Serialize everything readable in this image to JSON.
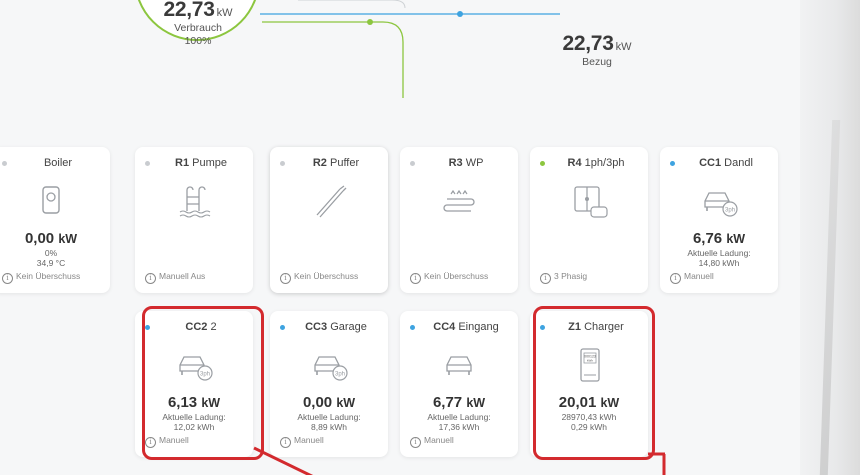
{
  "flow": {
    "consumption": {
      "value": "22,73",
      "unit": "kW",
      "label": "Verbrauch",
      "percent": "100%"
    },
    "grid": {
      "value": "22,73",
      "unit": "kW",
      "label": "Bezug"
    }
  },
  "colors": {
    "green": "#8cc63f",
    "blue": "#3ea3e0",
    "highlight": "#d32a2e"
  },
  "cards": [
    {
      "prefix": "",
      "name": "Boiler",
      "power": "0,00",
      "unit": "kW",
      "sub": [
        "0%",
        "34,9 °C"
      ],
      "footer": "Kein Überschuss",
      "icon": "boiler-icon",
      "status_color": "#c9ccd0"
    },
    {
      "prefix": "R1",
      "name": "Pumpe",
      "power": "",
      "unit": "",
      "sub": [],
      "footer": "Manuell Aus",
      "icon": "pool-ladder-icon",
      "status_color": "#c9ccd0"
    },
    {
      "prefix": "R2",
      "name": "Puffer",
      "power": "",
      "unit": "",
      "sub": [],
      "footer": "Kein Überschuss",
      "icon": "heating-rod-icon",
      "status_color": "#c9ccd0"
    },
    {
      "prefix": "R3",
      "name": "WP",
      "power": "",
      "unit": "",
      "sub": [],
      "footer": "Kein Überschuss",
      "icon": "heat-pump-icon",
      "status_color": "#c9ccd0"
    },
    {
      "prefix": "R4",
      "name": "1ph/3ph",
      "power": "",
      "unit": "",
      "sub": [],
      "footer": "3 Phasig",
      "icon": "phase-switch-icon",
      "status_color": "#8cc63f"
    },
    {
      "prefix": "CC1",
      "name": "Dandl",
      "power": "6,76",
      "unit": "kW",
      "sub": [
        "Aktuelle Ladung:",
        "14,80 kWh"
      ],
      "footer": "Manuell",
      "icon": "car-3ph-icon",
      "status_color": "#3ea3e0"
    },
    {
      "prefix": "CC2",
      "name": "2",
      "power": "6,13",
      "unit": "kW",
      "sub": [
        "Aktuelle Ladung:",
        "12,02 kWh"
      ],
      "footer": "Manuell",
      "icon": "car-3ph-icon",
      "status_color": "#3ea3e0"
    },
    {
      "prefix": "CC3",
      "name": "Garage",
      "power": "0,00",
      "unit": "kW",
      "sub": [
        "Aktuelle Ladung:",
        "8,89 kWh"
      ],
      "footer": "Manuell",
      "icon": "car-3ph-icon",
      "status_color": "#3ea3e0"
    },
    {
      "prefix": "CC4",
      "name": "Eingang",
      "power": "6,77",
      "unit": "kW",
      "sub": [
        "Aktuelle Ladung:",
        "17,36 kWh"
      ],
      "footer": "Manuell",
      "icon": "car-icon",
      "status_color": "#3ea3e0"
    },
    {
      "prefix": "Z1",
      "name": "Charger",
      "power": "20,01",
      "unit": "kW",
      "sub": [
        "28970,43 kWh",
        "0,29 kWh"
      ],
      "footer": "",
      "icon": "meter-icon",
      "meter_text": [
        "000123",
        "kWh"
      ],
      "status_color": "#3ea3e0"
    }
  ]
}
